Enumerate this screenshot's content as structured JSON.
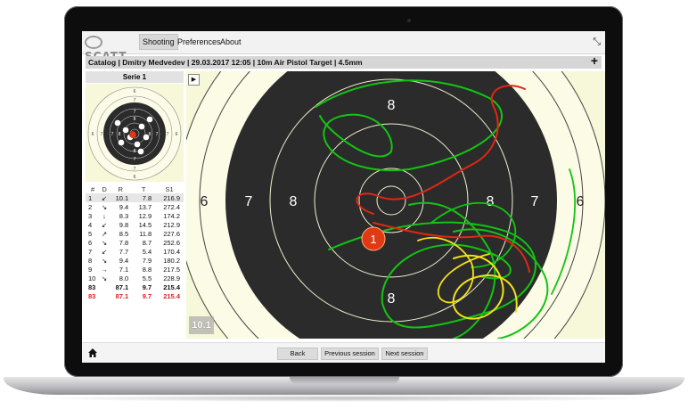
{
  "app": {
    "logo_text": "SCATT",
    "menu": [
      "Shooting",
      "Preferences",
      "About"
    ],
    "active_menu": "Shooting",
    "collapse_icon": "collapse-icon"
  },
  "session": {
    "title": "Catalog | Dmitry Medvedev | 29.03.2017 12:05 | 10m Air Pistol Target | 4.5mm"
  },
  "serie": {
    "title": "Serie 1",
    "columns": [
      "#",
      "D",
      "R",
      "T",
      "S1"
    ],
    "rows": [
      {
        "n": "1",
        "d": "↙",
        "r": "10.1",
        "t": "7.8",
        "s1": "216.9",
        "selected": true
      },
      {
        "n": "2",
        "d": "↘",
        "r": "9.4",
        "t": "13.7",
        "s1": "272.4"
      },
      {
        "n": "3",
        "d": "↓",
        "r": "8.3",
        "t": "12.9",
        "s1": "174.2"
      },
      {
        "n": "4",
        "d": "↙",
        "r": "9.8",
        "t": "14.5",
        "s1": "212.9"
      },
      {
        "n": "5",
        "d": "↗",
        "r": "8.5",
        "t": "11.8",
        "s1": "227.6"
      },
      {
        "n": "6",
        "d": "↘",
        "r": "7.8",
        "t": "8.7",
        "s1": "252.6"
      },
      {
        "n": "7",
        "d": "↙",
        "r": "7.7",
        "t": "5.4",
        "s1": "170.4"
      },
      {
        "n": "8",
        "d": "↘",
        "r": "9.4",
        "t": "7.9",
        "s1": "180.2"
      },
      {
        "n": "9",
        "d": "→",
        "r": "7.1",
        "s1": "217.5",
        "t": "8.8"
      },
      {
        "n": "10",
        "d": "↘",
        "r": "8.0",
        "t": "5.5",
        "s1": "228.9"
      }
    ],
    "total": {
      "n": "83",
      "r": "87.1",
      "t": "9.7",
      "s1": "215.4"
    },
    "total_red": {
      "n": "83",
      "r": "87.1",
      "t": "9.7",
      "s1": "215.4"
    }
  },
  "target": {
    "ring_numbers_left": [
      "6",
      "7",
      "8"
    ],
    "ring_numbers_right": [
      "8",
      "7",
      "6"
    ],
    "ring_number_top": "8",
    "ring_number_bottom": "8",
    "shot_label": "1",
    "last_score": "10.1",
    "play_icon": "play-icon",
    "colors": {
      "paper": "#f7f7d9",
      "black": "#2b2b2b",
      "trace_green": "#13c413",
      "trace_yellow": "#f2e21a",
      "trace_red": "#e02814",
      "shot": "#e03a14"
    }
  },
  "thumbnail": {
    "shots": [
      "1",
      "2",
      "3",
      "4",
      "5",
      "6",
      "7",
      "8",
      "9",
      "10"
    ]
  },
  "nav": {
    "back": "Back",
    "previous": "Previous session",
    "next": "Next session",
    "home_icon": "home-icon"
  }
}
